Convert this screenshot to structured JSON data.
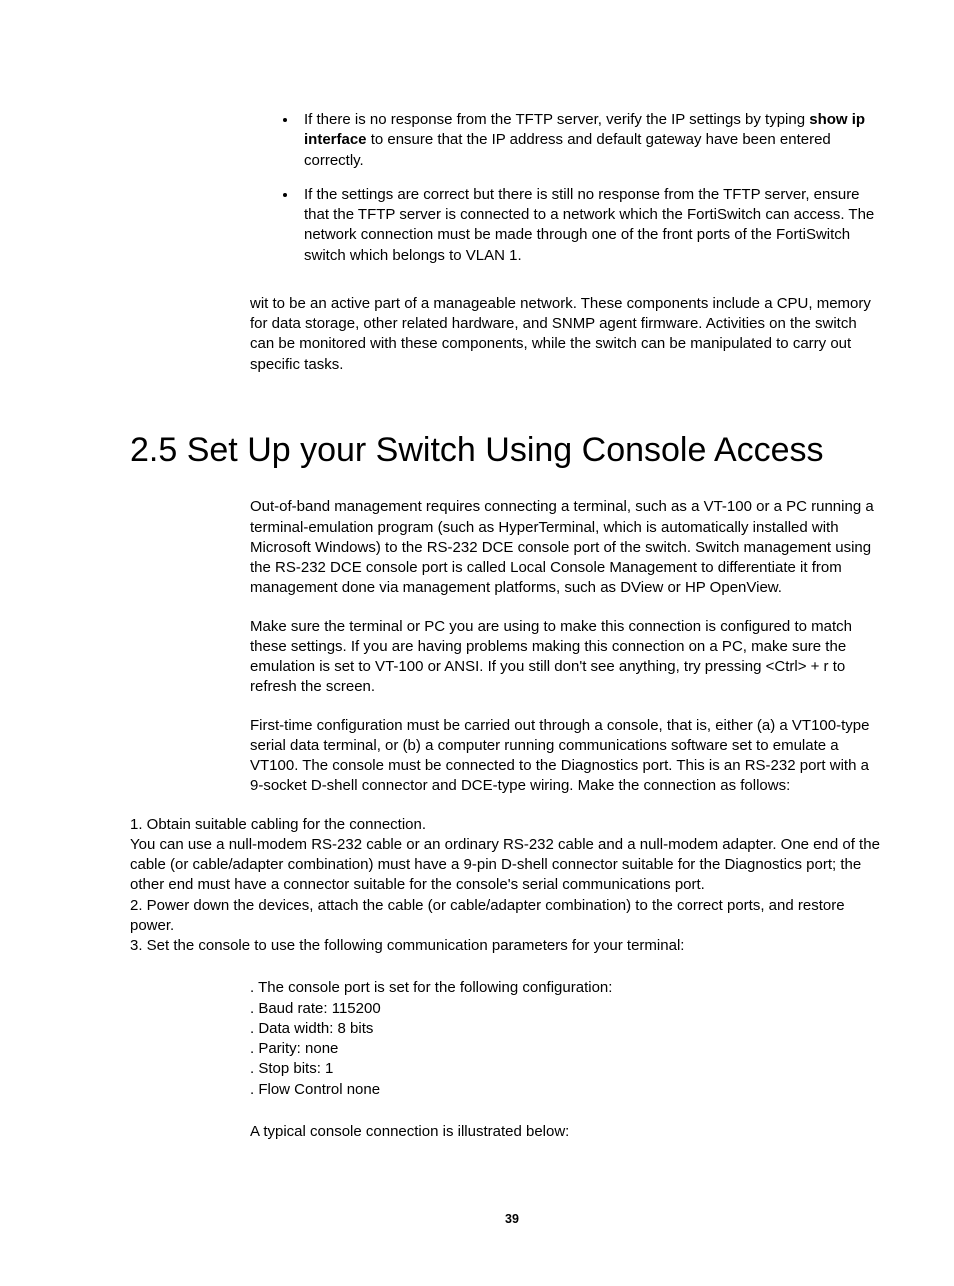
{
  "bullets": [
    {
      "pre": "If there is no response from the TFTP server, verify the IP settings by typing ",
      "bold": "show ip interface",
      "post": " to ensure that the IP address and default gateway have been entered correctly."
    },
    {
      "text": "If the settings are correct but there is still no response from the TFTP server, ensure that the TFTP server is connected to a network which the FortiSwitch can access. The network connection must be made through one of the front ports of the FortiSwitch switch which belongs to VLAN 1."
    }
  ],
  "intro_para": "wit to be an active part of a manageable network. These components include a CPU, memory for data storage, other related hardware, and SNMP agent firmware. Activities on the switch can be monitored with these components, while the switch can be manipulated to carry out specific tasks.",
  "heading": "2.5 Set Up your Switch Using Console Access",
  "p1": "Out-of-band management requires connecting a terminal, such as a VT-100 or a PC running a terminal-emulation program (such as HyperTerminal, which is automatically installed with Microsoft Windows) to the RS-232 DCE console port of the switch. Switch management using the RS-232 DCE console port is called Local Console Management to differentiate it from management done via management platforms, such as DView or HP OpenView.",
  "p2": "Make sure the terminal or PC you are using to make this connection is configured to match these settings. If you are having problems making this connection on a PC, make sure the emulation is set to VT-100 or ANSI. If you still don't see anything, try pressing <Ctrl> + r to refresh the screen.",
  "p3": "First-time configuration must be carried out through a console, that is, either (a) a VT100-type serial data terminal, or (b) a computer running communications software set to emulate a VT100. The console must be connected to the Diagnostics port. This is an RS-232 port with a 9-socket D-shell connector and DCE-type wiring. Make the connection as follows:",
  "steps": {
    "s1a": "1. Obtain suitable cabling for the connection.",
    "s1b": "You can use a null-modem RS-232 cable or an ordinary RS-232 cable and a null-modem adapter. One end of the cable (or cable/adapter combination) must have a 9-pin D-shell connector suitable for the Diagnostics port; the other end must have a connector suitable for the console's serial communications port.",
    "s2": "2. Power down the devices, attach the cable (or cable/adapter combination) to the correct ports, and restore power.",
    "s3": "3. Set the console to use the following communication parameters for your terminal:"
  },
  "config": {
    "c1": ". The console port is set for the following configuration:",
    "c2": ". Baud rate: 115200",
    "c3": ". Data width: 8 bits",
    "c4": ". Parity: none",
    "c5": ". Stop bits: 1",
    "c6": ". Flow Control none"
  },
  "closing": "A typical console connection is illustrated below:",
  "page_number": "39"
}
